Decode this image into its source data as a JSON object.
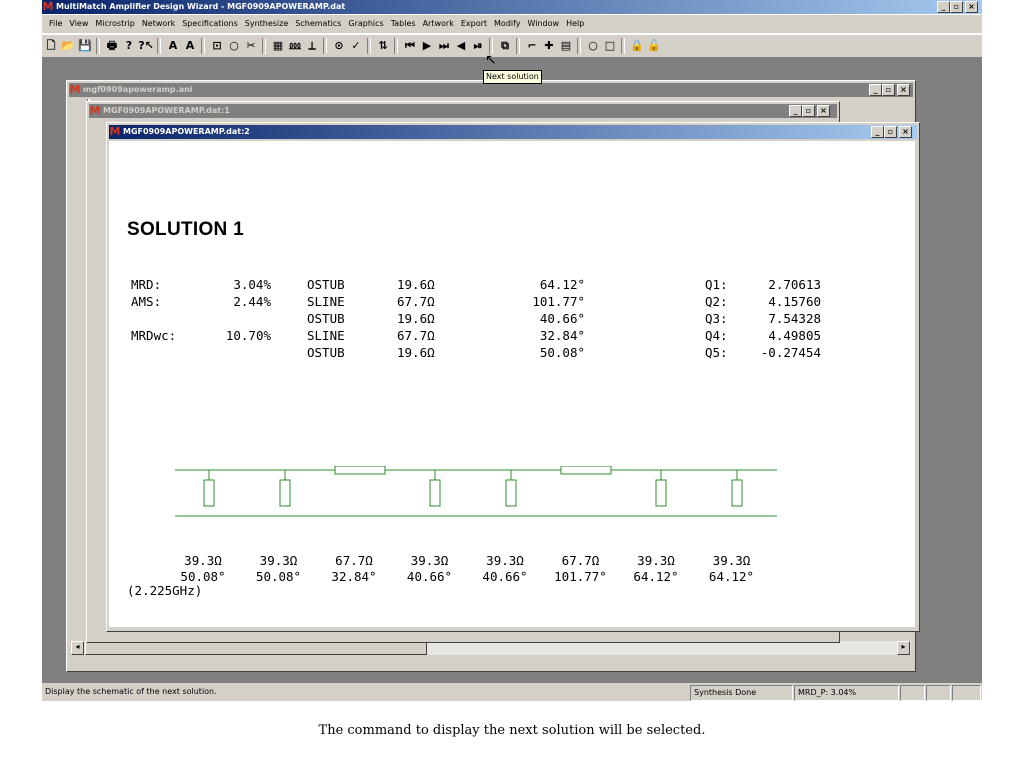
{
  "app": {
    "title": "MultiMatch Amplifier Design Wizard - MGF0909APOWERAMP.dat",
    "icon": "multimatch-logo-icon",
    "min": "_",
    "max": "▫",
    "close": "×"
  },
  "menu": [
    "File",
    "View",
    "Microstrip",
    "Network",
    "Specifications",
    "Synthesize",
    "Schematics",
    "Graphics",
    "Tables",
    "Artwork",
    "Export",
    "Modify",
    "Window",
    "Help"
  ],
  "toolbar": {
    "icons": [
      "new-icon",
      "open-icon",
      "save-icon",
      "print-icon",
      "help-icon",
      "context-help-icon",
      "tool-a-icon",
      "tool-a2-icon",
      "tool-box-icon",
      "circle-icon",
      "cut-icon",
      "grid-icon",
      "network-icon",
      "connect-icon",
      "target-icon",
      "check-icon",
      "tune-icon",
      "first-solution-icon",
      "next-solution-icon",
      "last-solution-icon",
      "prev-icon",
      "end-icon",
      "copy-icon",
      "bracket-icon",
      "cross-icon",
      "list-icon",
      "ring-icon",
      "square-icon",
      "lock-icon",
      "lock2-icon"
    ],
    "glyphs": [
      "🗋",
      "📂",
      "💾",
      "🖶",
      "?",
      "?↖",
      "A",
      "A",
      "⊡",
      "○",
      "✂",
      "▦",
      "⅏",
      "⟂",
      "⊙",
      "✓",
      "⇅",
      "⏮",
      "▶",
      "⏭",
      "◀",
      "⏯",
      "⧉",
      "⌐",
      "✚",
      "▤",
      "○",
      "□",
      "🔒",
      "🔓"
    ],
    "tooltip": "Next solution"
  },
  "windows": {
    "ani_title": "mgf0909apoweramp.ani",
    "dat1_title": "MGF0909APOWERAMP.dat:1",
    "dat2_title": "MGF0909APOWERAMP.dat:2"
  },
  "solution": {
    "heading": "SOLUTION 1",
    "left": [
      {
        "label": "MRD:",
        "value": "3.04%"
      },
      {
        "label": "AMS:",
        "value": "2.44%"
      },
      {
        "label": "",
        "value": ""
      },
      {
        "label": "MRDwc:",
        "value": "10.70%"
      },
      {
        "label": "",
        "value": ""
      }
    ],
    "elements": [
      {
        "type": "OSTUB",
        "z": "19.6Ω",
        "angle": "64.12°"
      },
      {
        "type": "SLINE",
        "z": "67.7Ω",
        "angle": "101.77°"
      },
      {
        "type": "OSTUB",
        "z": "19.6Ω",
        "angle": "40.66°"
      },
      {
        "type": "SLINE",
        "z": "67.7Ω",
        "angle": "32.84°"
      },
      {
        "type": "OSTUB",
        "z": "19.6Ω",
        "angle": "50.08°"
      }
    ],
    "q": [
      {
        "label": "Q1:",
        "value": "2.70613"
      },
      {
        "label": "Q2:",
        "value": "4.15760"
      },
      {
        "label": "Q3:",
        "value": "7.54328"
      },
      {
        "label": "Q4:",
        "value": "4.49805"
      },
      {
        "label": "Q5:",
        "value": "-0.27454"
      }
    ],
    "schematic_labels": [
      {
        "z": "39.3Ω",
        "a": "50.08°"
      },
      {
        "z": "39.3Ω",
        "a": "50.08°"
      },
      {
        "z": "67.7Ω",
        "a": "32.84°"
      },
      {
        "z": "39.3Ω",
        "a": "40.66°"
      },
      {
        "z": "39.3Ω",
        "a": "40.66°"
      },
      {
        "z": "67.7Ω",
        "a": "101.77°"
      },
      {
        "z": "39.3Ω",
        "a": "64.12°"
      },
      {
        "z": "39.3Ω",
        "a": "64.12°"
      }
    ],
    "frequency": "(2.225GHz)"
  },
  "status": {
    "message": "Display the schematic of the next solution.",
    "state": "Synthesis Done",
    "mrd": "MRD_P: 3.04%"
  },
  "caption": "The command to display the next solution will be selected.",
  "colors": {
    "schematic": "#2e8b2e",
    "title_active": "#0a246a"
  }
}
